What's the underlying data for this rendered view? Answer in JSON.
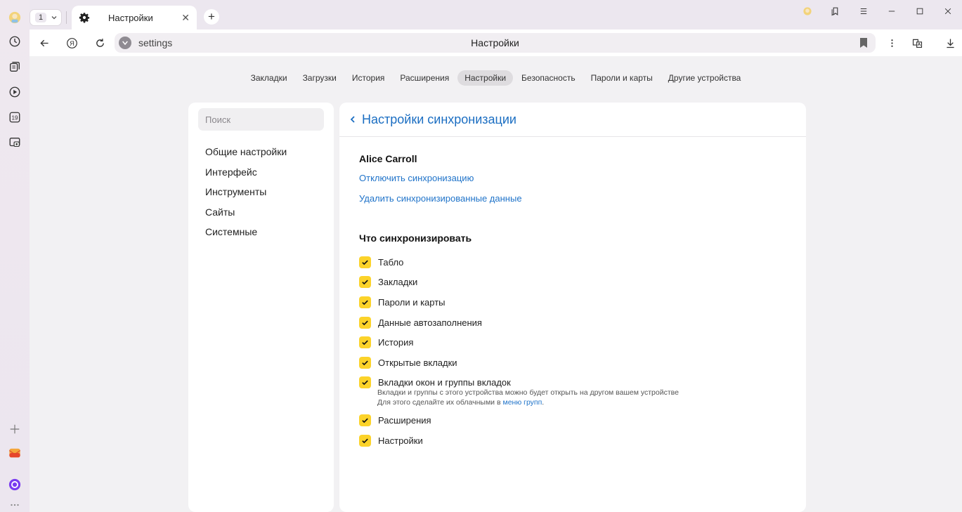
{
  "tabstrip": {
    "tab_count": "1",
    "active_tab_title": "Настройки",
    "new_tab_symbol": "+",
    "close_symbol": "✕"
  },
  "address_bar": {
    "url": "settings",
    "page_title": "Настройки"
  },
  "top_nav": [
    {
      "label": "Закладки",
      "active": false
    },
    {
      "label": "Загрузки",
      "active": false
    },
    {
      "label": "История",
      "active": false
    },
    {
      "label": "Расширения",
      "active": false
    },
    {
      "label": "Настройки",
      "active": true
    },
    {
      "label": "Безопасность",
      "active": false
    },
    {
      "label": "Пароли и карты",
      "active": false
    },
    {
      "label": "Другие устройства",
      "active": false
    }
  ],
  "sidebar": {
    "search_placeholder": "Поиск",
    "items": [
      "Общие настройки",
      "Интерфейс",
      "Инструменты",
      "Сайты",
      "Системные"
    ]
  },
  "main": {
    "title": "Настройки синхронизации",
    "user_name": "Alice Carroll",
    "disable_sync_link": "Отключить синхронизацию",
    "delete_data_link": "Удалить синхронизированные данные",
    "section_title": "Что синхронизировать",
    "options": [
      {
        "label": "Табло",
        "checked": true
      },
      {
        "label": "Закладки",
        "checked": true
      },
      {
        "label": "Пароли и карты",
        "checked": true
      },
      {
        "label": "Данные автозаполнения",
        "checked": true
      },
      {
        "label": "История",
        "checked": true
      },
      {
        "label": "Открытые вкладки",
        "checked": true
      },
      {
        "label": "Вкладки окон и группы вкладок",
        "checked": true
      },
      {
        "label": "Расширения",
        "checked": true
      },
      {
        "label": "Настройки",
        "checked": true
      }
    ],
    "hint_line1": "Вкладки и группы с этого устройства можно будет открыть на другом вашем устройстве",
    "hint_line2_prefix": "Для этого сделайте их облачными в ",
    "hint_link": "меню групп",
    "hint_suffix": "."
  },
  "colors": {
    "accent_link": "#1f73c9",
    "checkbox": "#fcd32a"
  },
  "icons": {
    "vertical_bar": [
      "avatar-icon",
      "history-icon",
      "collections-icon",
      "video-icon",
      "calendar-icon",
      "screenshot-icon",
      "add-icon",
      "mail-icon",
      "alice-icon",
      "more-icon"
    ],
    "calendar_day": "19"
  }
}
